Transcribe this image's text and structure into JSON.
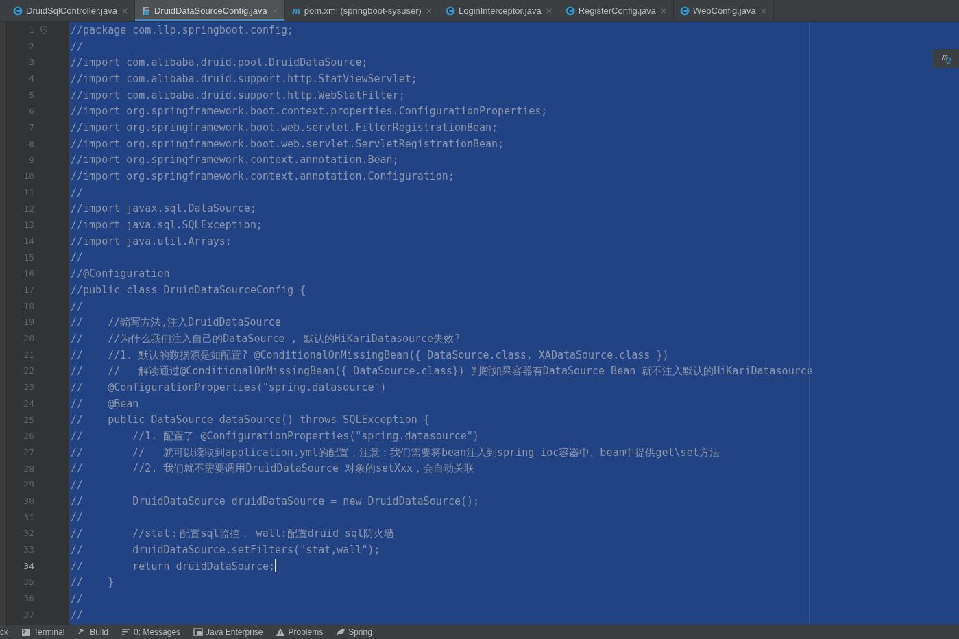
{
  "tabs": [
    {
      "label": "DruidSqlController.java",
      "kind": "class",
      "selected": false
    },
    {
      "label": "DruidDataSourceConfig.java",
      "kind": "config",
      "selected": true
    },
    {
      "label": "pom.xml (springboot-sysuser)",
      "kind": "maven",
      "selected": false
    },
    {
      "label": "LoginInterceptor.java",
      "kind": "class",
      "selected": false
    },
    {
      "label": "RegisterConfig.java",
      "kind": "class",
      "selected": false
    },
    {
      "label": "WebConfig.java",
      "kind": "class",
      "selected": false
    }
  ],
  "editor": {
    "lines": [
      {
        "number": "1",
        "text": "//package com.llp.springboot.config;",
        "current": false
      },
      {
        "number": "2",
        "text": "//",
        "current": false
      },
      {
        "number": "3",
        "text": "//import com.alibaba.druid.pool.DruidDataSource;",
        "current": false
      },
      {
        "number": "4",
        "text": "//import com.alibaba.druid.support.http.StatViewServlet;",
        "current": false
      },
      {
        "number": "5",
        "text": "//import com.alibaba.druid.support.http.WebStatFilter;",
        "current": false
      },
      {
        "number": "6",
        "text": "//import org.springframework.boot.context.properties.ConfigurationProperties;",
        "current": false
      },
      {
        "number": "7",
        "text": "//import org.springframework.boot.web.servlet.FilterRegistrationBean;",
        "current": false
      },
      {
        "number": "8",
        "text": "//import org.springframework.boot.web.servlet.ServletRegistrationBean;",
        "current": false
      },
      {
        "number": "9",
        "text": "//import org.springframework.context.annotation.Bean;",
        "current": false
      },
      {
        "number": "10",
        "text": "//import org.springframework.context.annotation.Configuration;",
        "current": false
      },
      {
        "number": "11",
        "text": "//",
        "current": false
      },
      {
        "number": "12",
        "text": "//import javax.sql.DataSource;",
        "current": false
      },
      {
        "number": "13",
        "text": "//import java.sql.SQLException;",
        "current": false
      },
      {
        "number": "14",
        "text": "//import java.util.Arrays;",
        "current": false
      },
      {
        "number": "15",
        "text": "//",
        "current": false
      },
      {
        "number": "16",
        "text": "//@Configuration",
        "current": false
      },
      {
        "number": "17",
        "text": "//public class DruidDataSourceConfig {",
        "current": false
      },
      {
        "number": "18",
        "text": "//",
        "current": false
      },
      {
        "number": "19",
        "text": "//    //编写方法,注入DruidDataSource",
        "current": false
      },
      {
        "number": "20",
        "text": "//    //为什么我们注入自己的DataSource , 默认的HiKariDatasource失效?",
        "current": false
      },
      {
        "number": "21",
        "text": "//    //1. 默认的数据源是如配置? @ConditionalOnMissingBean({ DataSource.class, XADataSource.class })",
        "current": false
      },
      {
        "number": "22",
        "text": "//    //   解读通过@ConditionalOnMissingBean({ DataSource.class}) 判断如果容器有DataSource Bean 就不注入默认的HiKariDatasource",
        "current": false
      },
      {
        "number": "23",
        "text": "//    @ConfigurationProperties(\"spring.datasource\")",
        "current": false
      },
      {
        "number": "24",
        "text": "//    @Bean",
        "current": false
      },
      {
        "number": "25",
        "text": "//    public DataSource dataSource() throws SQLException {",
        "current": false
      },
      {
        "number": "26",
        "text": "//        //1. 配置了 @ConfigurationProperties(\"spring.datasource\")",
        "current": false
      },
      {
        "number": "27",
        "text": "//        //   就可以读取到application.yml的配置，注意：我们需要将bean注入到spring ioc容器中、bean中提供get\\set方法",
        "current": false
      },
      {
        "number": "28",
        "text": "//        //2. 我们就不需要调用DruidDataSource 对象的setXxx，会自动关联",
        "current": false
      },
      {
        "number": "29",
        "text": "//",
        "current": false
      },
      {
        "number": "30",
        "text": "//        DruidDataSource druidDataSource = new DruidDataSource();",
        "current": false
      },
      {
        "number": "31",
        "text": "//",
        "current": false
      },
      {
        "number": "32",
        "text": "//        //stat：配置sql监控， wall:配置druid sql防火墙",
        "current": false
      },
      {
        "number": "33",
        "text": "//        druidDataSource.setFilters(\"stat,wall\");",
        "current": false
      },
      {
        "number": "34",
        "text": "//        return druidDataSource;",
        "current": true
      },
      {
        "number": "35",
        "text": "//    }",
        "current": false
      },
      {
        "number": "36",
        "text": "//",
        "current": false
      },
      {
        "number": "37",
        "text": "//",
        "current": false
      }
    ]
  },
  "tool_windows": [
    {
      "label": "ck",
      "kind": "plain"
    },
    {
      "label": "Terminal",
      "kind": "terminal"
    },
    {
      "label": "Build",
      "kind": "build"
    },
    {
      "label": "0: Messages",
      "kind": "messages"
    },
    {
      "label": "Java Enterprise",
      "kind": "enterprise"
    },
    {
      "label": "Problems",
      "kind": "problems"
    },
    {
      "label": "Spring",
      "kind": "spring"
    }
  ]
}
